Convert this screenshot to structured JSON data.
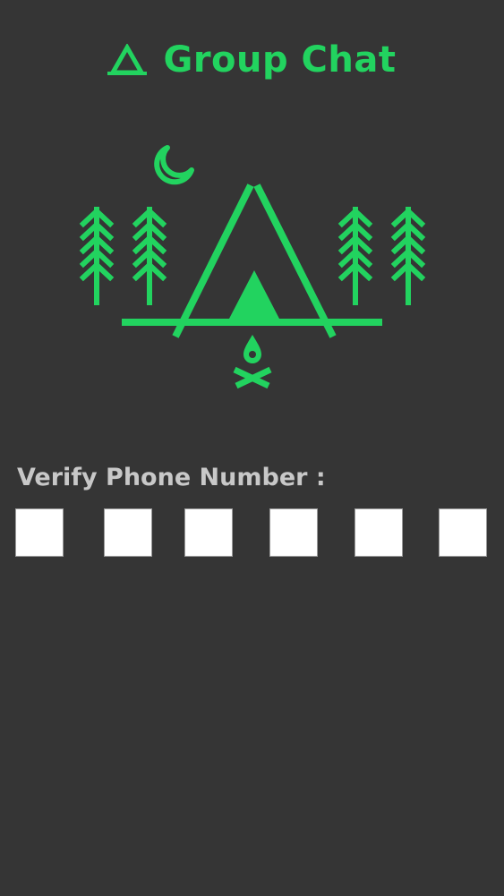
{
  "header": {
    "title": "Group Chat",
    "icon": "tent-icon"
  },
  "illustration": {
    "icons": [
      "moon-icon",
      "pine-tree-icon",
      "tent-icon",
      "campfire-icon"
    ]
  },
  "verify": {
    "label": "Verify Phone Number :",
    "code_digits": [
      "",
      "",
      "",
      "",
      "",
      ""
    ]
  },
  "colors": {
    "background": "#353535",
    "accent": "#22d35f",
    "label": "#c8c8c8",
    "input_bg": "#ffffff"
  }
}
